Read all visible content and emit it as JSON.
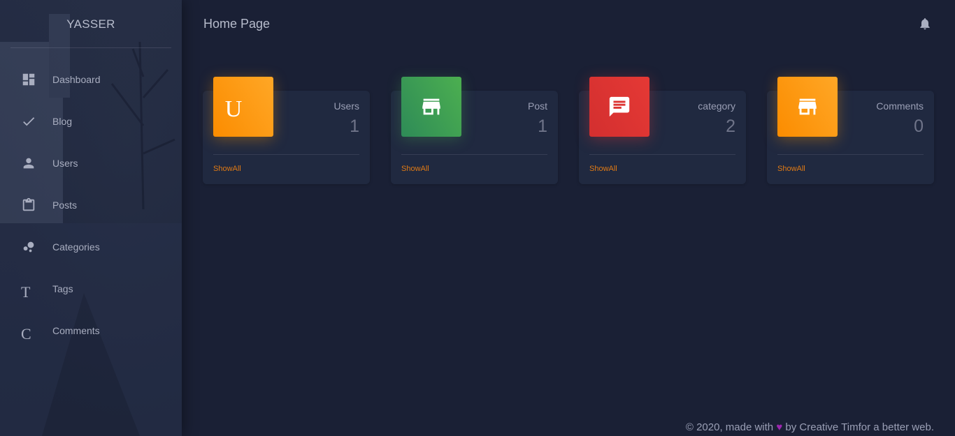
{
  "sidebar": {
    "brand": "YASSER",
    "items": [
      {
        "label": "Dashboard",
        "icon": "dashboard-icon"
      },
      {
        "label": "Blog",
        "icon": "check-icon"
      },
      {
        "label": "Users",
        "icon": "person-icon"
      },
      {
        "label": "Posts",
        "icon": "clipboard-icon"
      },
      {
        "label": "Categories",
        "icon": "bubble-chart-icon"
      },
      {
        "label": "Tags",
        "icon": "letter-t-icon",
        "letter": "T"
      },
      {
        "label": "Comments",
        "icon": "letter-c-icon",
        "letter": "C"
      }
    ]
  },
  "header": {
    "title": "Home Page",
    "notification_icon": "bell-icon"
  },
  "cards": [
    {
      "category": "Users",
      "value": "1",
      "link": "ShowAll",
      "icon": "letter-u-icon",
      "icon_letter": "U",
      "color": "#fb8c00"
    },
    {
      "category": "Post",
      "value": "1",
      "link": "ShowAll",
      "icon": "store-icon",
      "color": "#43a047"
    },
    {
      "category": "category",
      "value": "2",
      "link": "ShowAll",
      "icon": "comment-icon",
      "color": "#e53935"
    },
    {
      "category": "Comments",
      "value": "0",
      "link": "ShowAll",
      "icon": "store-icon",
      "color": "#fb8c00"
    }
  ],
  "footer": {
    "prefix": "© 2020, made with",
    "heart": "♥",
    "suffix": "by Creative Timfor a better web."
  }
}
